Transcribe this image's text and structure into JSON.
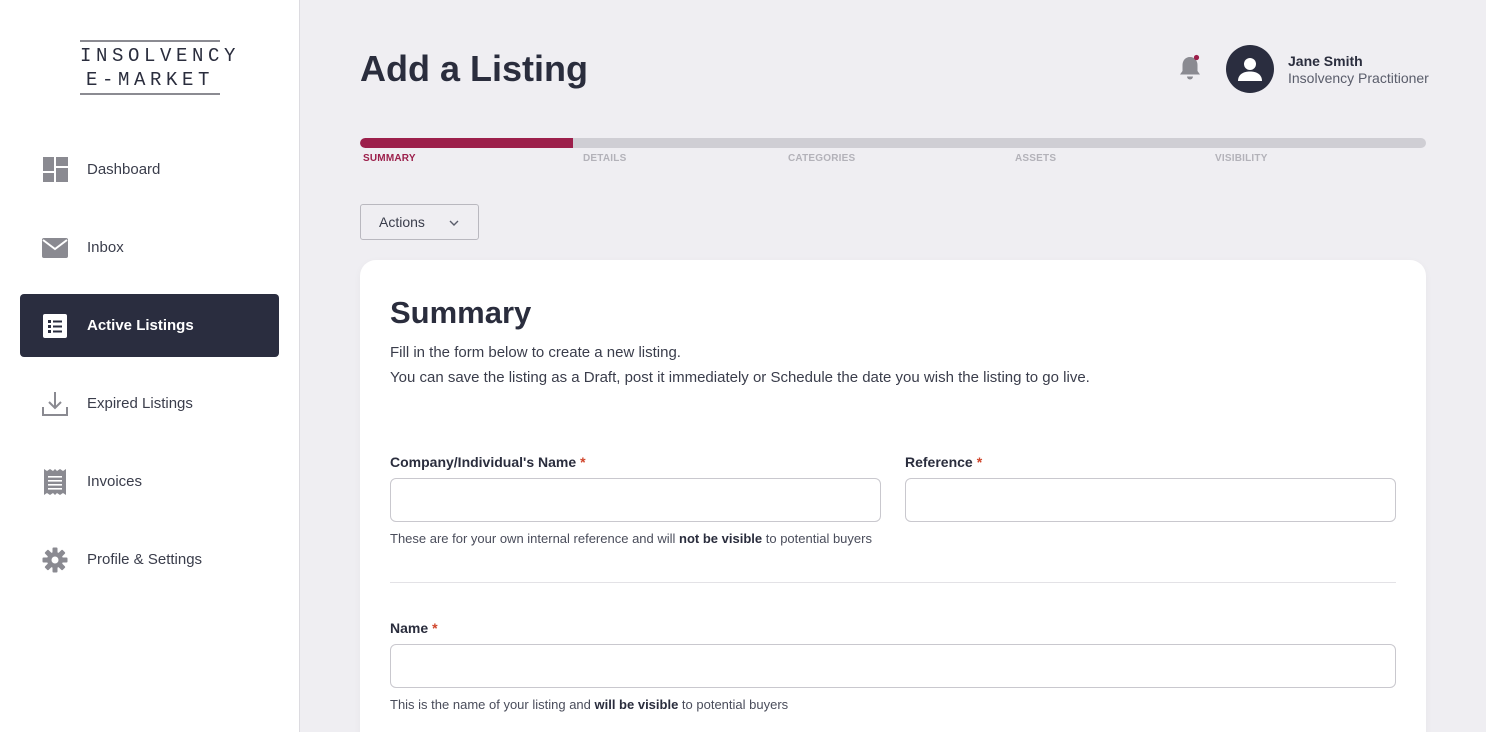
{
  "logo": {
    "line1": "INSOLVENCY",
    "line2": "E-MARKET"
  },
  "sidebar": {
    "items": [
      {
        "label": "Dashboard",
        "icon": "dashboard-icon",
        "active": false
      },
      {
        "label": "Inbox",
        "icon": "mail-icon",
        "active": false
      },
      {
        "label": "Active Listings",
        "icon": "list-icon",
        "active": true
      },
      {
        "label": "Expired Listings",
        "icon": "download-icon",
        "active": false
      },
      {
        "label": "Invoices",
        "icon": "receipt-icon",
        "active": false
      },
      {
        "label": "Profile & Settings",
        "icon": "gear-icon",
        "active": false
      }
    ]
  },
  "header": {
    "title": "Add a Listing",
    "user_name": "Jane Smith",
    "user_role": "Insolvency Practitioner"
  },
  "stepper": {
    "progress": 0.2,
    "steps": [
      "SUMMARY",
      "DETAILS",
      "CATEGORIES",
      "ASSETS",
      "VISIBILITY"
    ],
    "current": 0
  },
  "actions": {
    "label": "Actions"
  },
  "card": {
    "title": "Summary",
    "desc1": "Fill in the form below to create a new listing.",
    "desc2": "You can save the listing as a Draft, post it immediately or Schedule the date you wish the listing to go live.",
    "company_label": "Company/Individual's Name",
    "reference_label": "Reference",
    "required_mark": "*",
    "help1_pre": "These are for your own internal reference and will ",
    "help1_bold": "not be visible",
    "help1_post": " to potential buyers",
    "name_label": "Name",
    "help2_pre": "This is the name of your listing and ",
    "help2_bold": "will be visible",
    "help2_post": " to potential buyers"
  },
  "colors": {
    "accent": "#9c1f4b",
    "sidebar_active": "#2a2d3f",
    "required": "#d0452b"
  }
}
